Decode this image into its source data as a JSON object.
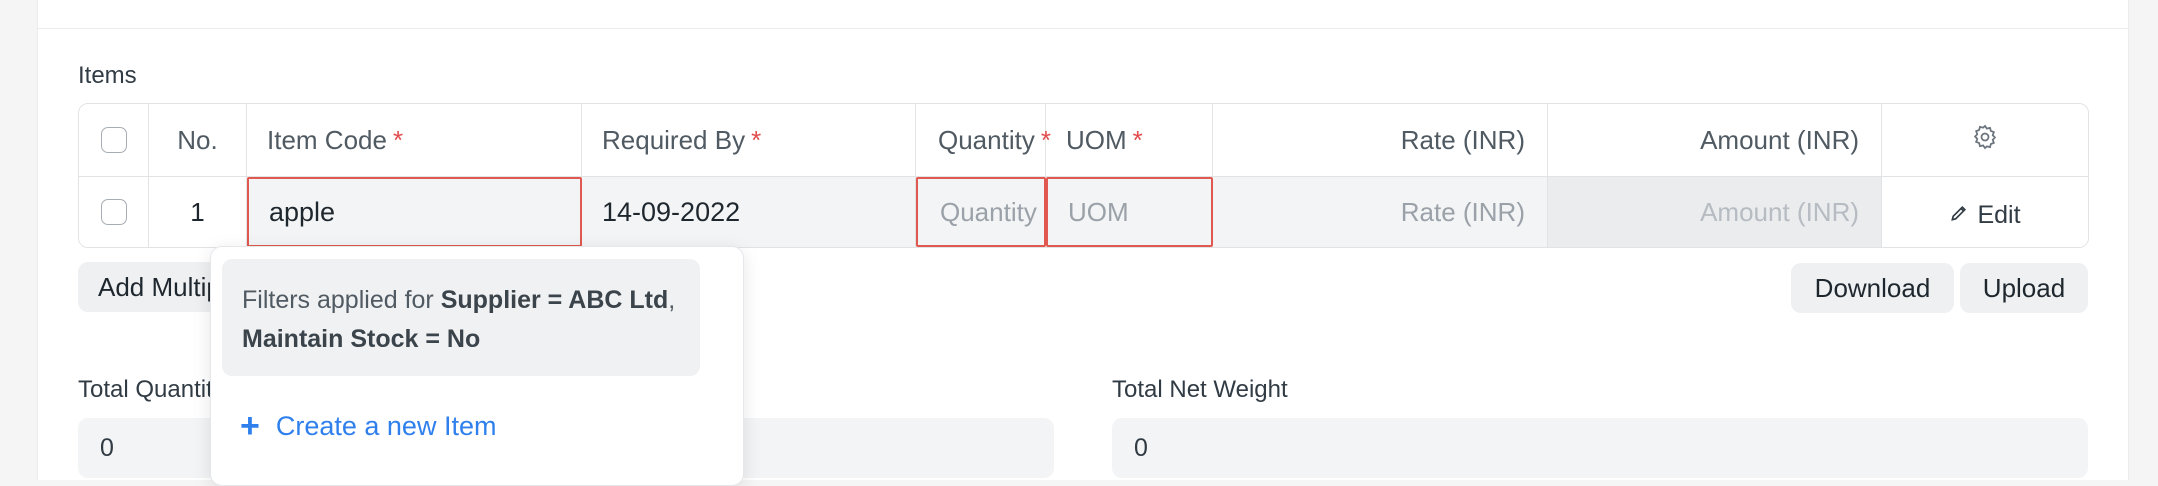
{
  "items_section": {
    "label": "Items",
    "columns": [
      "No.",
      "Item Code",
      "Required By",
      "Quantity",
      "UOM",
      "Rate (INR)",
      "Amount (INR)"
    ],
    "required_marker": "*",
    "row": {
      "no": "1",
      "item_code": "apple",
      "required_by": "14-09-2022",
      "quantity_placeholder": "Quantity",
      "uom_placeholder": "UOM",
      "rate_placeholder": "Rate (INR)",
      "amount_placeholder": "Amount (INR)",
      "edit_label": "Edit"
    }
  },
  "buttons": {
    "add_multiple": "Add Multiple",
    "download": "Download",
    "upload": "Upload"
  },
  "dropdown": {
    "filter_prefix": "Filters applied for ",
    "filter_1": "Supplier = ABC Ltd",
    "separator": ", ",
    "filter_2": "Maintain Stock = No",
    "create_label": "Create a new Item"
  },
  "totals": {
    "total_quantity_label": "Total Quantity",
    "total_quantity_value": "0",
    "total_net_weight_label": "Total Net Weight",
    "total_net_weight_value": "0"
  },
  "colors": {
    "required": "#e24c4c",
    "focus_border": "#e0584f",
    "link": "#2f80ed"
  }
}
